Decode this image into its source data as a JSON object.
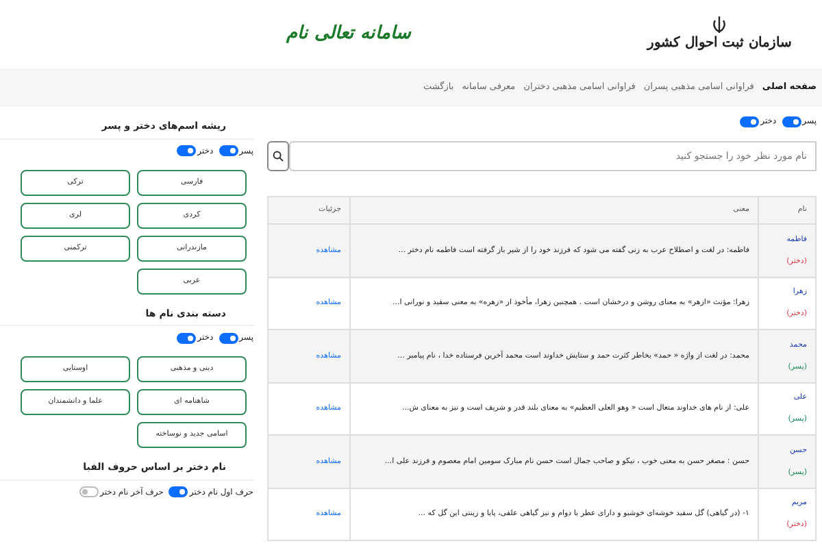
{
  "header": {
    "logo_text": "سازمان ثبت احوال کشور",
    "site_title": "سامانه تعالی نام"
  },
  "nav": [
    {
      "label": "صفحه اصلی",
      "selected": true
    },
    {
      "label": "فراوانی اسامی مذهبی پسران",
      "selected": false
    },
    {
      "label": "فراوانی اسامی مذهبی دختران",
      "selected": false
    },
    {
      "label": "معرفی سامانه",
      "selected": false
    },
    {
      "label": "بازگشت",
      "selected": false
    }
  ],
  "main": {
    "filters": [
      {
        "label": "پسر",
        "on": true
      },
      {
        "label": "دختر",
        "on": true
      }
    ],
    "search": {
      "placeholder": "نام مورد نظر خود را جستجو کنید"
    },
    "table": {
      "columns": [
        "نام",
        "معنی",
        "جزئیات"
      ],
      "rows": [
        {
          "name": "فاطمه",
          "gender": "(دختر)",
          "color": "#dc3545",
          "meaning": "فاطمه: در لغت و اصطلاح عرب به زنی گفته می شود که فرزند خود را از شیر باز گرفته است فاطمه نام دختر ...",
          "link": "مشاهده"
        },
        {
          "name": "زهرا",
          "gender": "(دختر)",
          "color": "#dc3545",
          "meaning": "زهرا: مؤنث «ازهر» به معنای روشن و درخشان است . همچنین زهرا، مأخوذ از «زهره» به معنی سفید و نورانی ا...",
          "link": "مشاهده"
        },
        {
          "name": "محمد",
          "gender": "(پسر)",
          "color": "#198754",
          "meaning": "محمد: در لغت از واژه « حمد» بخاطر کثرت حمد و ستایش خداوند است محمد آخرین فرستاده خدا ، نام پیامبر ...",
          "link": "مشاهده"
        },
        {
          "name": "علی",
          "gender": "(پسر)",
          "color": "#198754",
          "meaning": "علی: از نام های خداوند متعال است « وهو العلی العظیم» به معنای بلند قدر و شریف است و نیز به معنای ش...",
          "link": "مشاهده"
        },
        {
          "name": "حسن",
          "gender": "(پسر)",
          "color": "#198754",
          "meaning": "حسن : مصغر حسن به معنی خوب ، نیکو و صاحب جمال است حسن نام مبارک سومین امام معصوم و فرزند علی ا...",
          "link": "مشاهده"
        },
        {
          "name": "مریم",
          "gender": "(دختر)",
          "color": "#dc3545",
          "meaning": "۱- (در گیاهی) گل سفید خوشه‌ای خوشبو و دارای عطر با دوام و نیز گیاهی علفی، پایا و زینتی این گل که ...",
          "link": "مشاهده"
        }
      ]
    }
  },
  "sidebar": [
    {
      "title": "ریشه اسم‌های دختر و پسر",
      "filters": [
        {
          "label": "پسر",
          "on": true
        },
        {
          "label": "دختر",
          "on": true
        }
      ],
      "buttons": [
        "فارسی",
        "ترکی",
        "کردی",
        "لری",
        "مازندرانی",
        "ترکمنی",
        "عربی"
      ]
    },
    {
      "title": "دسته بندی نام ها",
      "filters": [
        {
          "label": "پسر",
          "on": true
        },
        {
          "label": "دختر",
          "on": true
        }
      ],
      "buttons": [
        "دینی و مذهبی",
        "اوستایی",
        "شاهنامه ای",
        "علما و دانشمندان",
        "اسامی جدید و نوساخته"
      ]
    },
    {
      "title": "نام دختر بر اساس حروف الفبا",
      "filters": [
        {
          "label": "حرف اول نام دختر",
          "on": true
        },
        {
          "label": "حرف آخر نام دختر",
          "on": false
        }
      ]
    }
  ]
}
